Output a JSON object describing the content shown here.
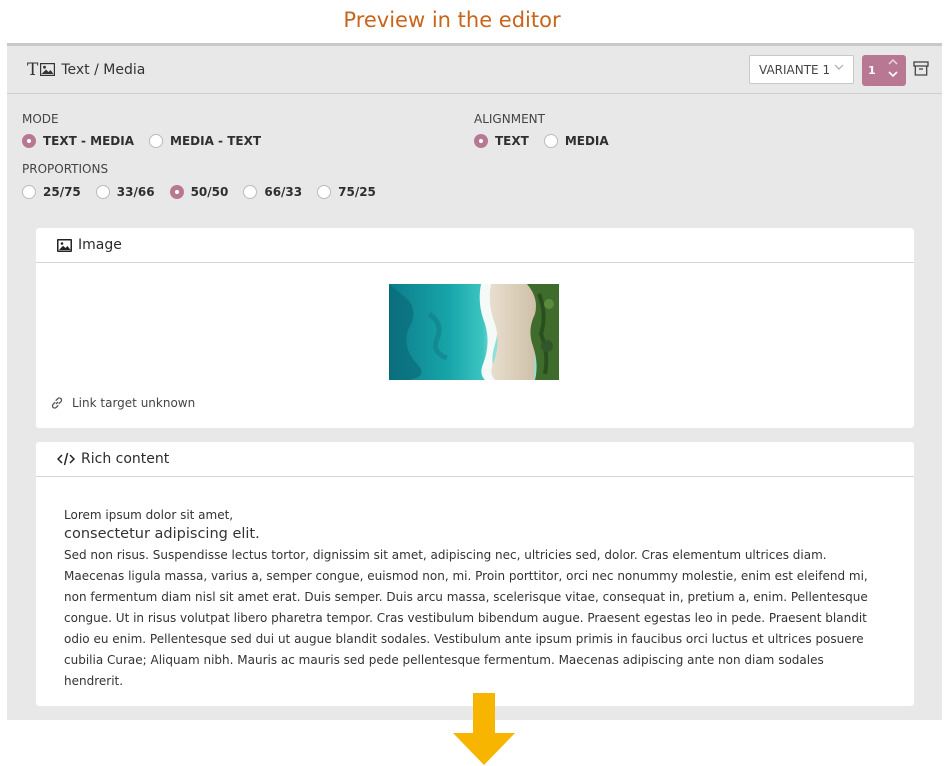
{
  "heading": "Preview in the editor",
  "component": {
    "title": "Text / Media",
    "variant": "VARIANTE 1",
    "count": "1"
  },
  "mode": {
    "label": "MODE",
    "options": [
      "TEXT - MEDIA",
      "MEDIA - TEXT"
    ],
    "selected": "TEXT - MEDIA"
  },
  "alignment": {
    "label": "ALIGNMENT",
    "options": [
      "TEXT",
      "MEDIA"
    ],
    "selected": "TEXT"
  },
  "proportions": {
    "label": "PROPORTIONS",
    "options": [
      "25/75",
      "33/66",
      "50/50",
      "66/33",
      "75/25"
    ],
    "selected": "50/50"
  },
  "image_card": {
    "title": "Image",
    "link_text": "Link target unknown"
  },
  "rich_card": {
    "title": "Rich content",
    "line1": "Lorem ipsum dolor sit amet,",
    "heading": "consectetur adipiscing elit.",
    "body": "Sed non risus. Suspendisse lectus tortor, dignissim sit amet, adipiscing nec, ultricies sed, dolor. Cras elementum ultrices diam. Maecenas ligula massa, varius a, semper congue, euismod non, mi. Proin porttitor, orci nec nonummy molestie, enim est eleifend mi, non fermentum diam nisl sit amet erat. Duis semper. Duis arcu massa, scelerisque vitae, consequat in, pretium a, enim. Pellentesque congue. Ut in risus volutpat libero pharetra tempor. Cras vestibulum bibendum augue. Praesent egestas leo in pede. Praesent blandit odio eu enim. Pellentesque sed dui ut augue blandit sodales. Vestibulum ante ipsum primis in faucibus orci luctus et ultrices posuere cubilia Curae; Aliquam nibh. Mauris ac mauris sed pede pellentesque fermentum. Maecenas adipiscing ante non diam sodales hendrerit."
  },
  "colors": {
    "accent": "#b87893",
    "heading": "#c8651b",
    "arrow": "#f7b500"
  }
}
